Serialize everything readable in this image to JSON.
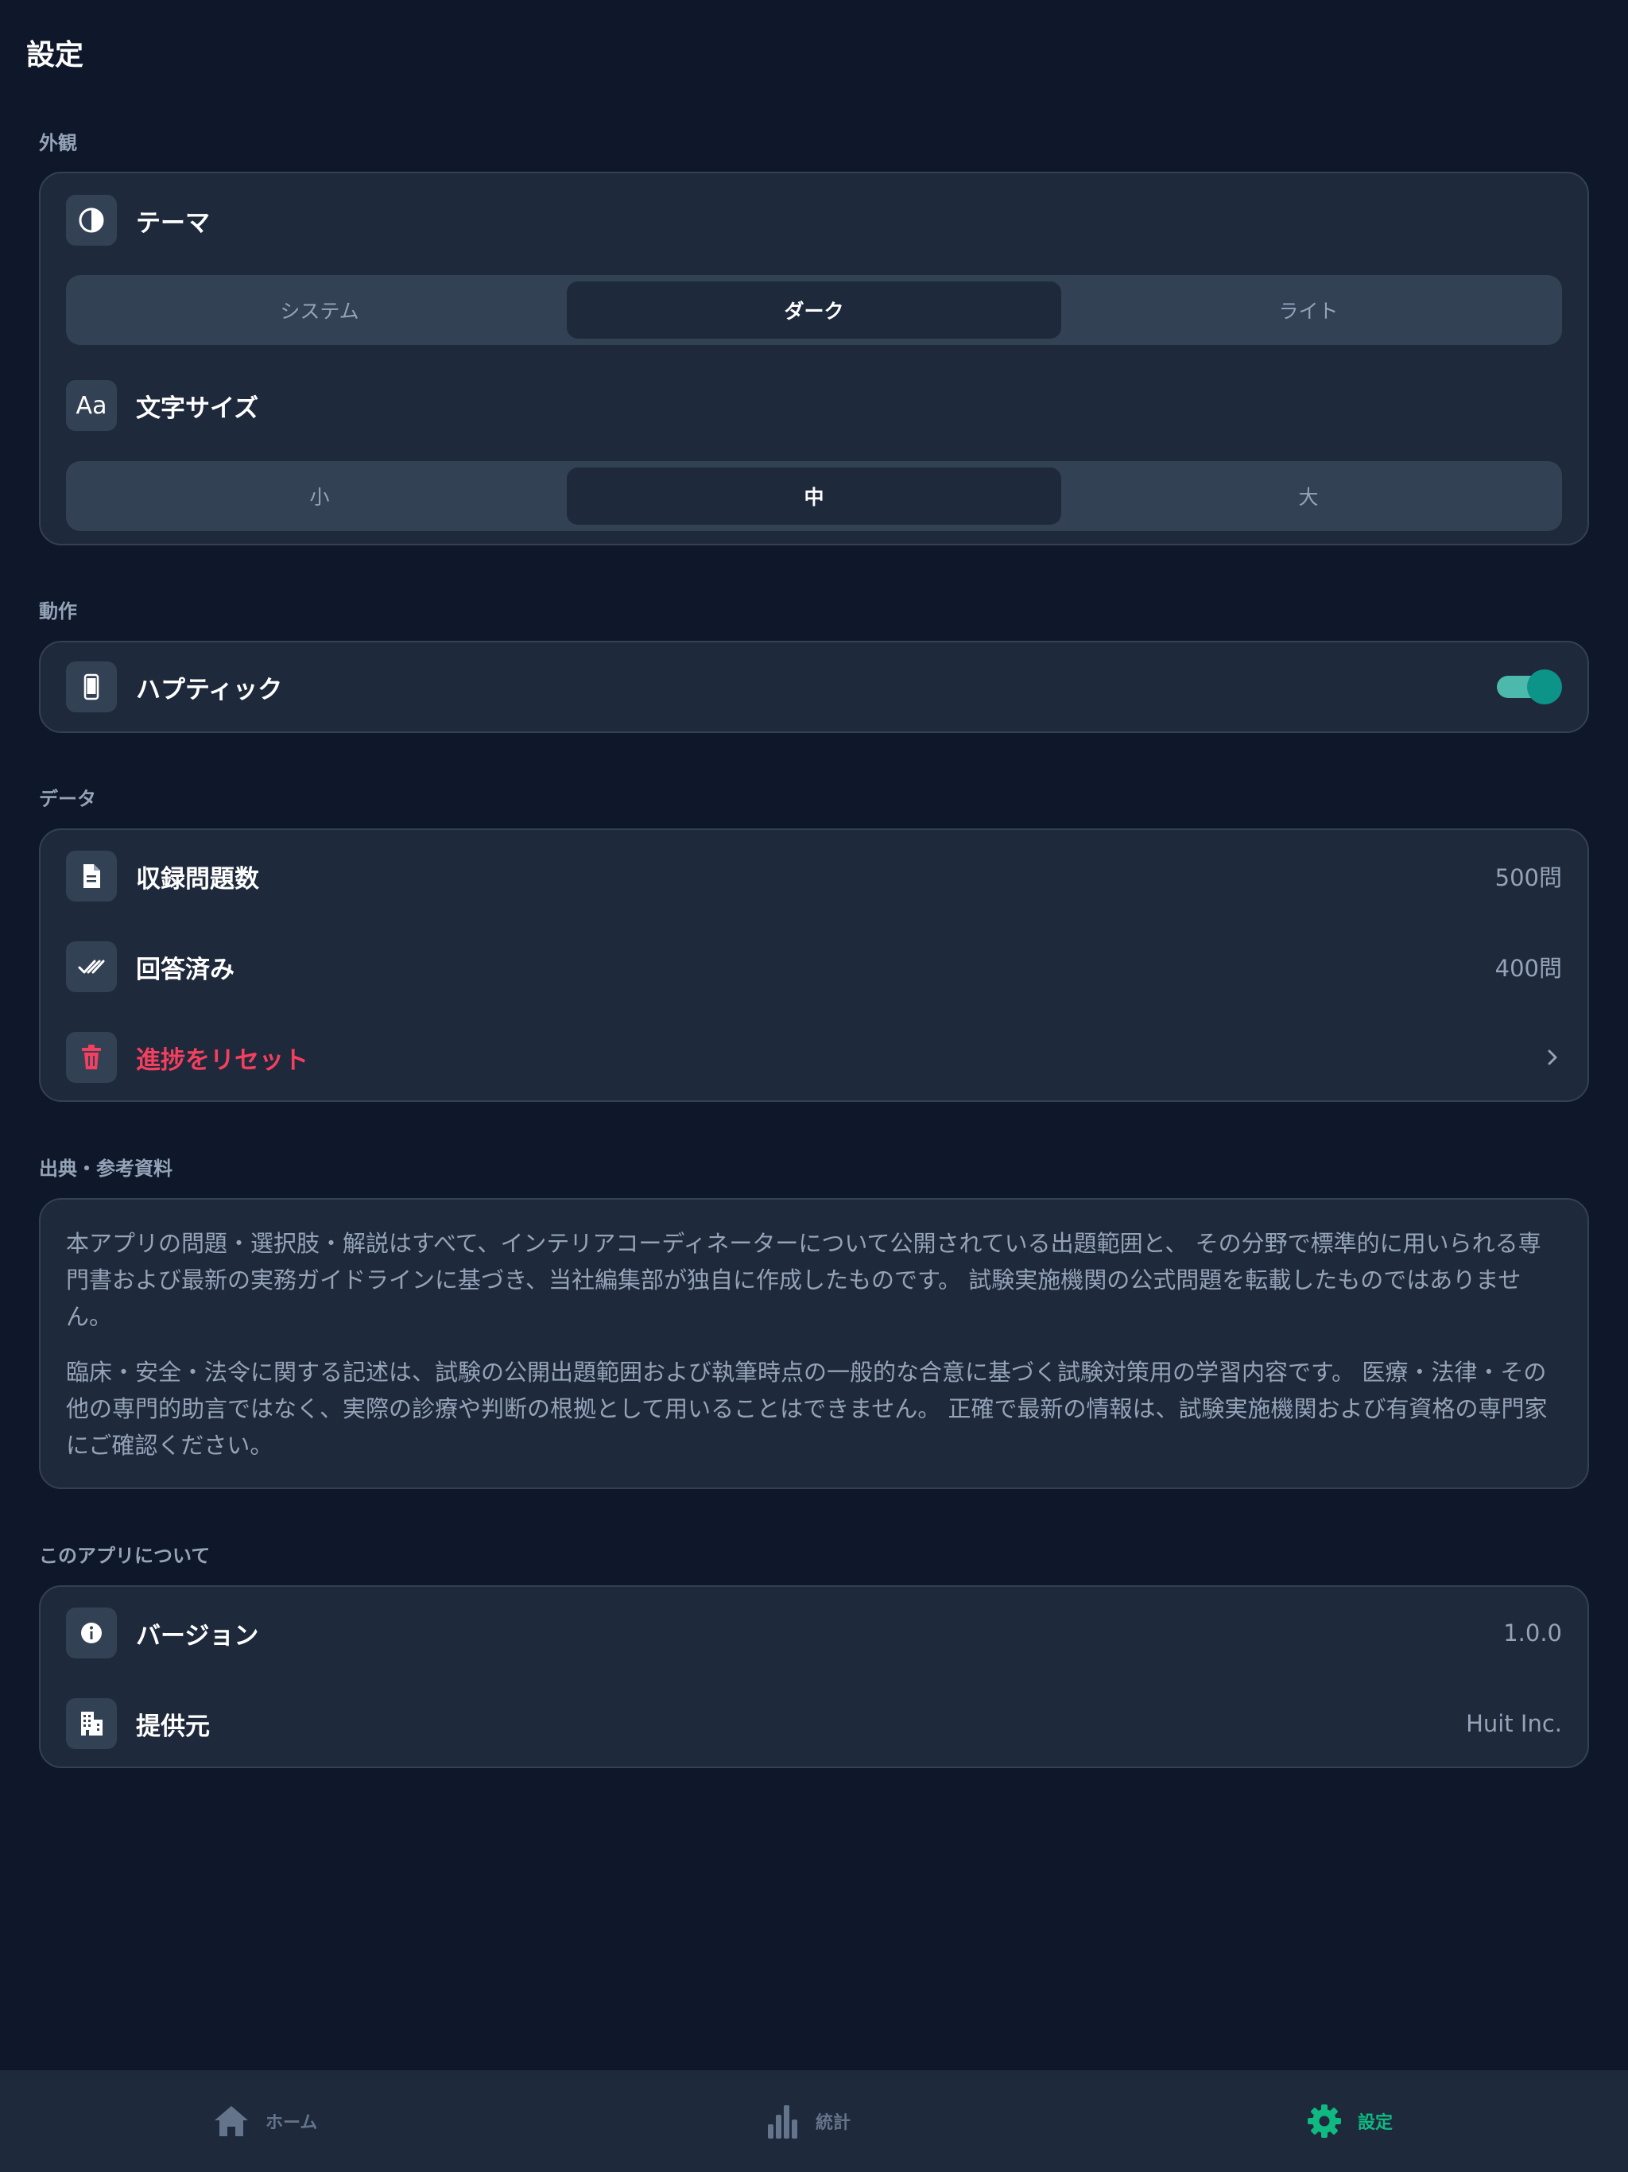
{
  "header": {
    "title": "設定"
  },
  "sections": {
    "appearance": {
      "label": "外観",
      "theme": {
        "label": "テーマ",
        "icon": "contrast-icon",
        "options": [
          "システム",
          "ダーク",
          "ライト"
        ],
        "selected": "ダーク"
      },
      "font_size": {
        "label": "文字サイズ",
        "icon_text": "Aa",
        "options": [
          "小",
          "中",
          "大"
        ],
        "selected": "中"
      }
    },
    "behavior": {
      "label": "動作",
      "haptic": {
        "label": "ハプティック",
        "icon": "phone-icon",
        "enabled": true
      }
    },
    "data": {
      "label": "データ",
      "questions": {
        "label": "収録問題数",
        "value": "500問",
        "icon": "document-icon"
      },
      "answered": {
        "label": "回答済み",
        "value": "400問",
        "icon": "double-check-icon"
      },
      "reset": {
        "label": "進捗をリセット",
        "icon": "trash-icon"
      }
    },
    "sources": {
      "label": "出典・参考資料",
      "paragraphs": [
        "本アプリの問題・選択肢・解説はすべて、インテリアコーディネーターについて公開されている出題範囲と、 その分野で標準的に用いられる専門書および最新の実務ガイドラインに基づき、当社編集部が独自に作成したものです。 試験実施機関の公式問題を転載したものではありません。",
        "臨床・安全・法令に関する記述は、試験の公開出題範囲および執筆時点の一般的な合意に基づく試験対策用の学習内容です。 医療・法律・その他の専門的助言ではなく、実際の診療や判断の根拠として用いることはできません。 正確で最新の情報は、試験実施機関および有資格の専門家にご確認ください。"
      ]
    },
    "about": {
      "label": "このアプリについて",
      "version": {
        "label": "バージョン",
        "value": "1.0.0",
        "icon": "info-icon"
      },
      "provider": {
        "label": "提供元",
        "value": "Huit Inc.",
        "icon": "building-icon"
      }
    }
  },
  "tabbar": {
    "items": [
      {
        "label": "ホーム",
        "icon": "home-icon",
        "active": false
      },
      {
        "label": "統計",
        "icon": "bar-chart-icon",
        "active": false
      },
      {
        "label": "設定",
        "icon": "gear-icon",
        "active": true
      }
    ]
  },
  "colors": {
    "background": "#0f172a",
    "card": "#1e293b",
    "accent": "#10b981",
    "danger": "#f43f5e",
    "toggle": "#0d9488"
  }
}
